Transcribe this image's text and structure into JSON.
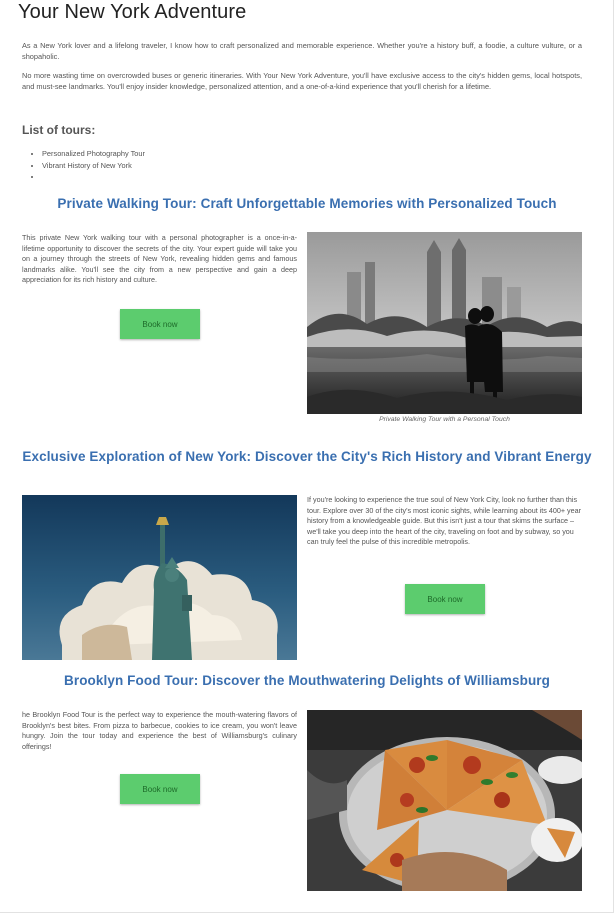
{
  "page": {
    "title": "Your New York Adventure",
    "intro_1": "As a New York lover and a lifelong traveler, I know how to craft personalized and memorable experience. Whether you're a history buff, a foodie, a culture vulture, or a shopaholic.",
    "intro_2": "No more wasting time on overcrowded buses or generic itineraries. With Your New York Adventure, you'll have exclusive access to the city's hidden gems, local hotspots, and must-see landmarks. You'll enjoy insider knowledge, personalized attention, and a one-of-a-kind experience that you'll cherish for a lifetime.",
    "tours_heading": "List of tours:",
    "tour_list": [
      "Personalized Photography Tour",
      "Vibrant History of New York",
      ""
    ]
  },
  "sections": [
    {
      "title": "Private Walking Tour: Craft Unforgettable Memories with Personalized Touch",
      "text": "This private New York walking tour with a personal photographer is a once-in-a-lifetime opportunity to discover the secrets of the city. Your expert guide will take you on a journey through the streets of New York, revealing hidden gems and famous landmarks alike. You'll see the city from a new perspective and gain a deep appreciation for its rich history and culture.",
      "button": "Book now",
      "caption": "Private Walking Tour with a Personal Touch"
    },
    {
      "title": "Exclusive Exploration of New York: Discover the City's Rich History and Vibrant Energy",
      "text": "If you're looking to experience the true soul of New York City, look no further than this tour. Explore over 30 of the city's most iconic sights, while learning about its 400+ year history from a knowledgeable guide. But this isn't just a tour that skims the surface – we'll take you deep into the heart of the city, traveling on foot and by subway, so you can truly feel the pulse of this incredible metropolis.",
      "button": "Book now"
    },
    {
      "title": "Brooklyn Food Tour: Discover the Mouthwatering Delights of Williamsburg",
      "text": "he Brooklyn Food Tour is the perfect way to experience the mouth-watering flavors of Brooklyn's best bites. From pizza to barbecue, cookies to ice cream, you won't leave hungry. Join the tour today and experience the best of Williamsburg's culinary offerings!",
      "button": "Book now"
    }
  ],
  "colors": {
    "accent_title": "#3a6fb0",
    "button_bg": "#5ccc6e"
  }
}
